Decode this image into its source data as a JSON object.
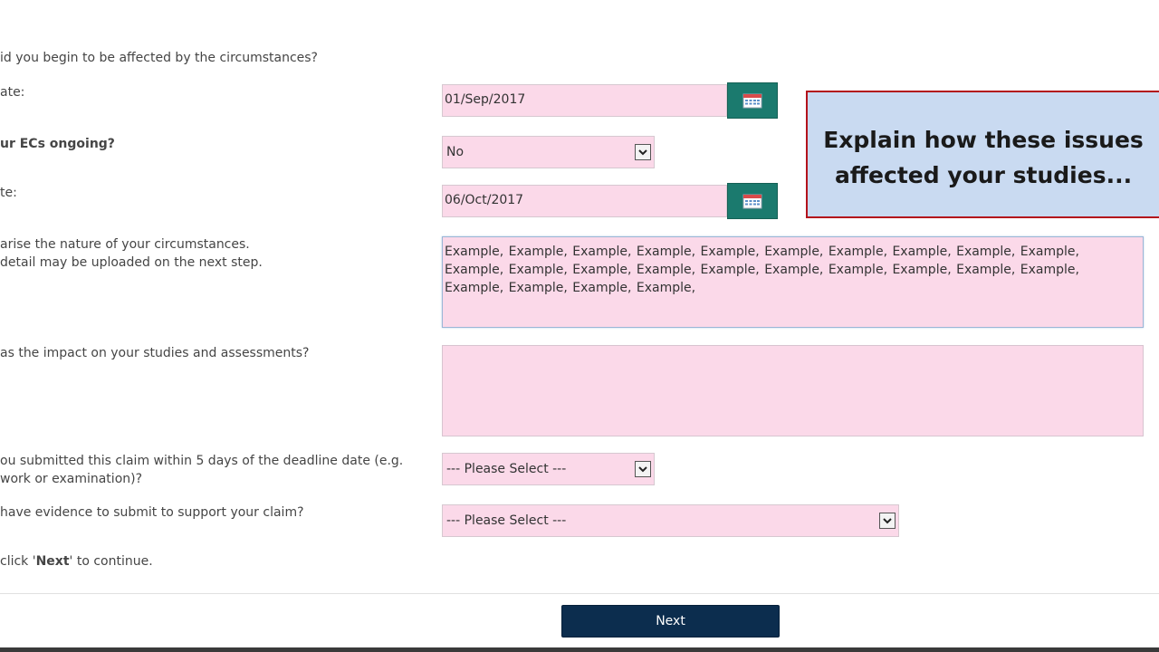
{
  "form": {
    "q_begin": "id you begin to be affected by the circumstances?",
    "start_date_label": "ate:",
    "start_date_value": "01/Sep/2017",
    "ongoing_label": "ur ECs ongoing?",
    "ongoing_value": "No",
    "end_date_label": "te:",
    "end_date_value": "06/Oct/2017",
    "nature_label_line1": "arise the nature of your circumstances.",
    "nature_label_line2": " detail may be uploaded on the next step.",
    "nature_text": "Example, Example, Example, Example, Example, Example, Example, Example, Example, Example, Example, Example, Example, Example, Example, Example, Example, Example, Example, Example, Example, Example, Example, Example,",
    "impact_label": "as the impact on your studies and assessments?",
    "impact_text": "",
    "deadline_label_line1": "ou submitted this claim within 5 days of the deadline date (e.g.",
    "deadline_label_line2": "work or examination)?",
    "deadline_value": "--- Please Select ---",
    "evidence_label": " have evidence to submit to support your claim?",
    "evidence_value": "--- Please Select ---",
    "continue_prefix": "click '",
    "continue_bold": "Next",
    "continue_suffix": "' to continue.",
    "next_label": "Next"
  },
  "callout": {
    "line1": "Explain how these issues",
    "line2": "affected your studies..."
  },
  "icons": {
    "calendar": "calendar-icon",
    "dropdown": "chevron-down-icon"
  },
  "colors": {
    "field_bg": "#fbd9e9",
    "calendar_button": "#1b7a6e",
    "next_button": "#0c2d4e",
    "callout_bg": "#c9daf1",
    "callout_border": "#b3121c"
  }
}
